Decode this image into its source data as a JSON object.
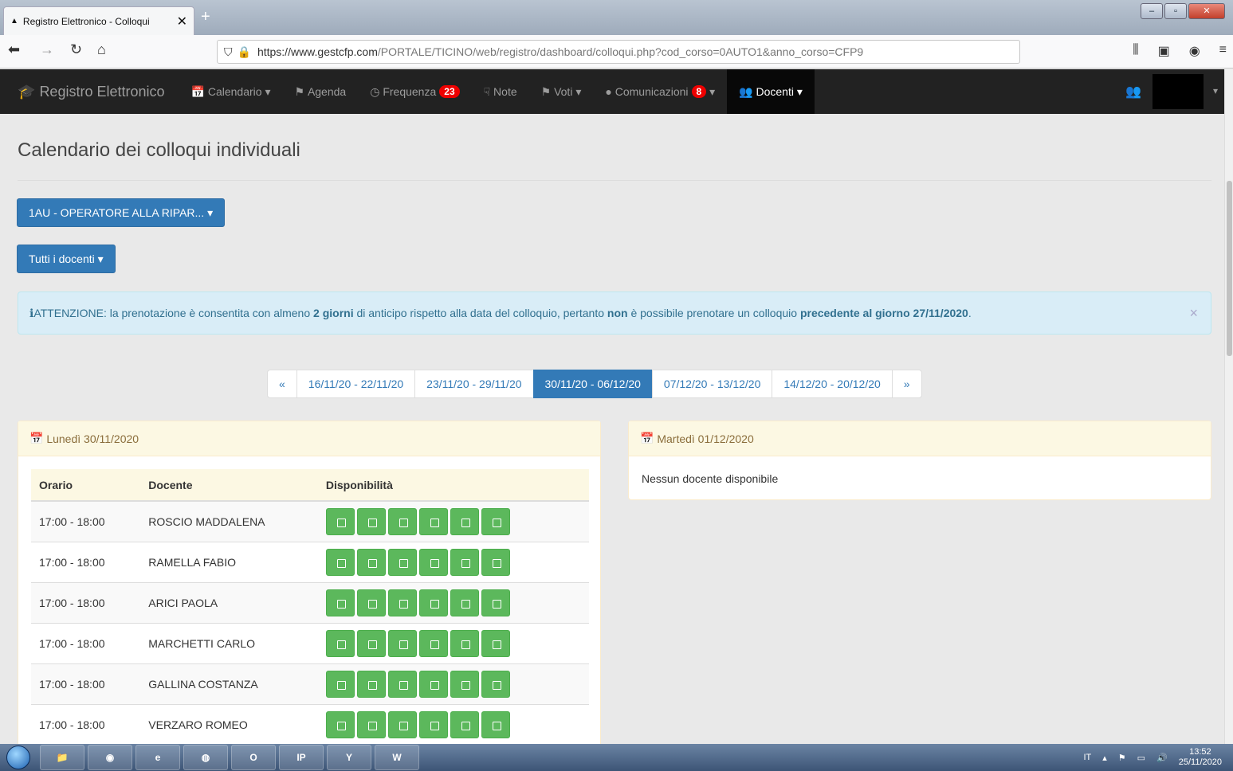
{
  "browser": {
    "tab_title": "Registro Elettronico - Colloqui",
    "url_host": "https://www.gestcfp.com",
    "url_path": "/PORTALE/TICINO/web/registro/dashboard/colloqui.php?cod_corso=0AUTO1&anno_corso=CFP9",
    "window_title": ""
  },
  "nav": {
    "brand": "Registro Elettronico",
    "items": [
      {
        "label": "Calendario",
        "icon": "calendar-icon",
        "caret": true
      },
      {
        "label": "Agenda",
        "icon": "tag-icon"
      },
      {
        "label": "Frequenza",
        "icon": "clock-icon",
        "badge": "23"
      },
      {
        "label": "Note",
        "icon": "thumbs-down-icon"
      },
      {
        "label": "Voti",
        "icon": "flag-icon",
        "caret": true
      },
      {
        "label": "Comunicazioni",
        "icon": "comment-icon",
        "badge": "8",
        "caret": true
      },
      {
        "label": "Docenti",
        "icon": "users-icon",
        "caret": true,
        "active": true
      }
    ]
  },
  "page": {
    "title": "Calendario dei colloqui individuali",
    "course_button": "1AU - OPERATORE ALLA RIPAR...",
    "teachers_button": "Tutti i docenti"
  },
  "alert": {
    "prefix": "ATTENZIONE: la prenotazione è consentita con almeno",
    "days": "2 giorni",
    "mid": "di anticipo rispetto alla data del colloquio, pertanto",
    "non": "non",
    "mid2": "è possibile prenotare un colloquio",
    "date": "precedente al giorno 27/11/2020",
    "end": "."
  },
  "pager": {
    "prev": "«",
    "weeks": [
      "16/11/20 - 22/11/20",
      "23/11/20 - 29/11/20",
      "30/11/20 - 06/12/20",
      "07/12/20 - 13/12/20",
      "14/12/20 - 20/12/20"
    ],
    "next": "»",
    "active_index": 2
  },
  "day1": {
    "title": "Lunedì 30/11/2020",
    "headers": [
      "Orario",
      "Docente",
      "Disponibilità"
    ],
    "rows": [
      {
        "time": "17:00 - 18:00",
        "teacher": "ROSCIO MADDALENA",
        "slots": 6
      },
      {
        "time": "17:00 - 18:00",
        "teacher": "RAMELLA FABIO",
        "slots": 6
      },
      {
        "time": "17:00 - 18:00",
        "teacher": "ARICI PAOLA",
        "slots": 6
      },
      {
        "time": "17:00 - 18:00",
        "teacher": "MARCHETTI CARLO",
        "slots": 6
      },
      {
        "time": "17:00 - 18:00",
        "teacher": "GALLINA COSTANZA",
        "slots": 6
      },
      {
        "time": "17:00 - 18:00",
        "teacher": "VERZARO ROMEO",
        "slots": 6
      }
    ]
  },
  "day2": {
    "title": "Martedì 01/12/2020",
    "empty": "Nessun docente disponibile"
  },
  "taskbar": {
    "lang": "IT",
    "time": "13:52",
    "date": "25/11/2020"
  }
}
